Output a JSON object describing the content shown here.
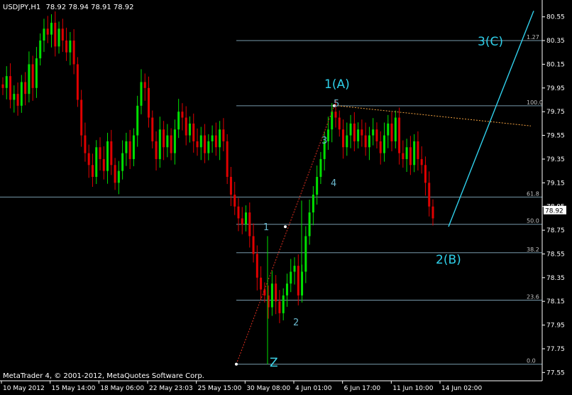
{
  "header": {
    "symbol": "USDJPY,H1",
    "ohlc": "78.92 78.94 78.91 78.92"
  },
  "footer": {
    "copyright": "MetaTrader 4, © 2001-2012, MetaQuotes Software Corp."
  },
  "colors": {
    "background": "#000000",
    "bull": "#00e000",
    "bear": "#e00000",
    "fib_line": "#8cb4c8",
    "cyan": "#30d0ec",
    "dotted_red": "#e03020",
    "dotted_orange": "#f0a040",
    "price_tag_bg": "#ffffff"
  },
  "price_tag": "78.92",
  "chart_data": {
    "type": "line",
    "title": "USDJPY,H1",
    "ylim": [
      77.48,
      80.68
    ],
    "y_ticks": [
      80.55,
      80.35,
      80.15,
      79.95,
      79.75,
      79.55,
      79.35,
      79.15,
      78.95,
      78.75,
      78.55,
      78.35,
      78.15,
      77.95,
      77.75,
      77.55
    ],
    "y_tick_labels": [
      "80.55",
      "80.35",
      "80.15",
      "79.95",
      "79.75",
      "79.55",
      "79.35",
      "79.15",
      "78.95",
      "78.75",
      "78.55",
      "78.35",
      "78.15",
      "77.95",
      "77.75",
      "77.55"
    ],
    "x_tick_labels": [
      "10 May 2012",
      "15 May 14:00",
      "18 May 06:00",
      "22 May 23:03",
      "25 May 15:00",
      "30 May 08:00",
      "4 Jun 01:00",
      "6 Jun 17:00",
      "11 Jun 10:00",
      "14 Jun 02:00"
    ],
    "series": [
      {
        "values": [
          79.95,
          80.05,
          79.85,
          79.9,
          79.8,
          80.0,
          79.9,
          80.15,
          79.95,
          80.2,
          80.35,
          80.45,
          80.4,
          80.5,
          80.3,
          80.45,
          80.35,
          80.25,
          80.35,
          80.15,
          79.85,
          79.55,
          79.4,
          79.3,
          79.2,
          79.45,
          79.35,
          79.25,
          79.5,
          79.3,
          79.15,
          79.25,
          79.4,
          79.5,
          79.35,
          79.55,
          79.8,
          80.0,
          79.95,
          79.7,
          79.5,
          79.35,
          79.6,
          79.45,
          79.55,
          79.4,
          79.6,
          79.75,
          79.7,
          79.55,
          79.65,
          79.5,
          79.45,
          79.55,
          79.4,
          79.5,
          79.55,
          79.45,
          79.6,
          79.5,
          79.2,
          79.05,
          78.95,
          78.85,
          78.8,
          78.9,
          78.7,
          78.55,
          78.35,
          78.25,
          78.2,
          78.1,
          78.3,
          78.15,
          78.05,
          78.2,
          78.3,
          78.4,
          78.45,
          78.2,
          78.4,
          78.7,
          78.9,
          79.05,
          79.2,
          79.35,
          79.5,
          79.6,
          79.75,
          79.7,
          79.6,
          79.45,
          79.55,
          79.65,
          79.5,
          79.6,
          79.55,
          79.45,
          79.55,
          79.6,
          79.5,
          79.4,
          79.55,
          79.65,
          79.5,
          79.7,
          79.4,
          79.35,
          79.45,
          79.3,
          79.5,
          79.35,
          79.3,
          79.15,
          78.95,
          78.85
        ]
      }
    ],
    "fib_levels": [
      {
        "label": "1.27",
        "value": 80.35
      },
      {
        "label": "100.0",
        "value": 79.8
      },
      {
        "label": "61.8",
        "value": 79.03
      },
      {
        "label": "50.0",
        "value": 78.8
      },
      {
        "label": "38.2",
        "value": 78.56
      },
      {
        "label": "23.6",
        "value": 78.16
      },
      {
        "label": "0.0",
        "value": 77.62
      }
    ],
    "annotations": [
      {
        "text": "1(A)",
        "size": "big"
      },
      {
        "text": "2(B)",
        "size": "big"
      },
      {
        "text": "3(C)",
        "size": "big"
      },
      {
        "text": "Z",
        "size": "z"
      },
      {
        "text": "1",
        "size": "small"
      },
      {
        "text": "2",
        "size": "small"
      },
      {
        "text": "3",
        "size": "small"
      },
      {
        "text": "4",
        "size": "small"
      },
      {
        "text": "5",
        "size": "small"
      }
    ]
  }
}
